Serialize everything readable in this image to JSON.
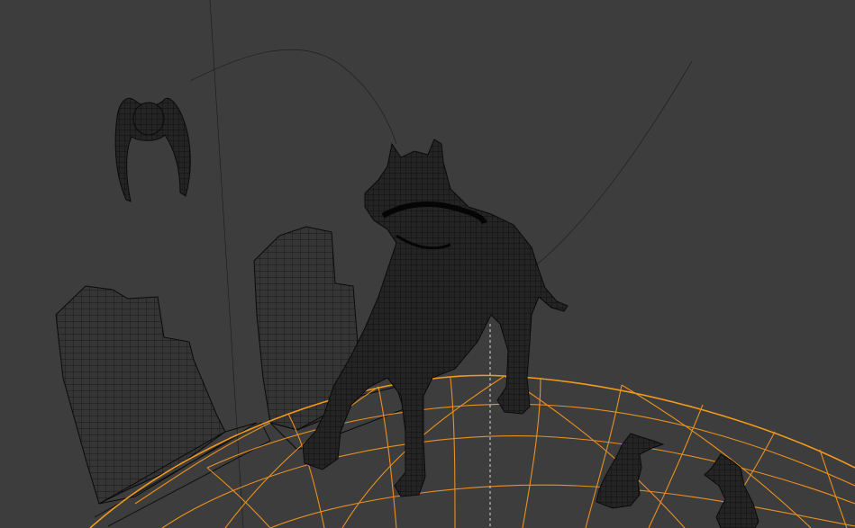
{
  "viewport": {
    "background": "#3d3d3d",
    "wire_color": "#0c0c0c",
    "selection_color": "#f29a1c"
  },
  "objects": [
    {
      "name": "wire-sphere",
      "selected": true
    },
    {
      "name": "wire-dog",
      "selected": false
    },
    {
      "name": "wire-skyscrapers-left",
      "selected": false
    },
    {
      "name": "wire-skyscrapers-middle",
      "selected": false
    },
    {
      "name": "wire-owl",
      "selected": false
    },
    {
      "name": "wire-hand-1",
      "selected": false
    },
    {
      "name": "wire-hand-2",
      "selected": false
    },
    {
      "name": "curve-path-1",
      "selected": false
    },
    {
      "name": "curve-path-2",
      "selected": false
    }
  ]
}
